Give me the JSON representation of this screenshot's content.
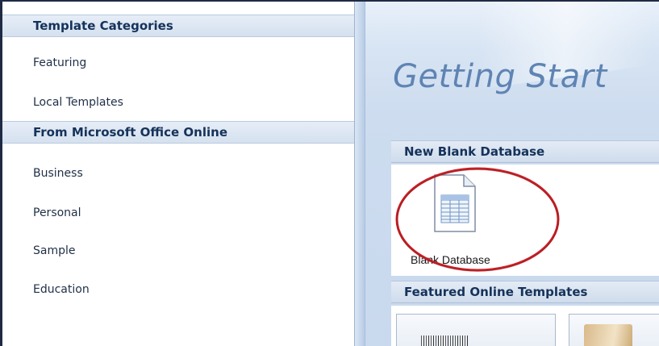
{
  "sidebar": {
    "header_categories": "Template Categories",
    "items_top": [
      "Featuring",
      "Local Templates"
    ],
    "header_online": "From Microsoft Office Online",
    "items_online": [
      "Business",
      "Personal",
      "Sample",
      "Education"
    ]
  },
  "main": {
    "title": "Getting Start",
    "new_blank_section": "New Blank Database",
    "blank_db_label": "Blank Database",
    "featured_section": "Featured Online Templates"
  },
  "colors": {
    "accent_title": "#5f84b3",
    "highlight_ring": "#c8232a",
    "header_text": "#15325a"
  },
  "icons": {
    "blank_db": "database-document-icon",
    "template_thumb_1": "template-thumbnail-icon",
    "template_thumb_2": "template-thumbnail-icon"
  }
}
